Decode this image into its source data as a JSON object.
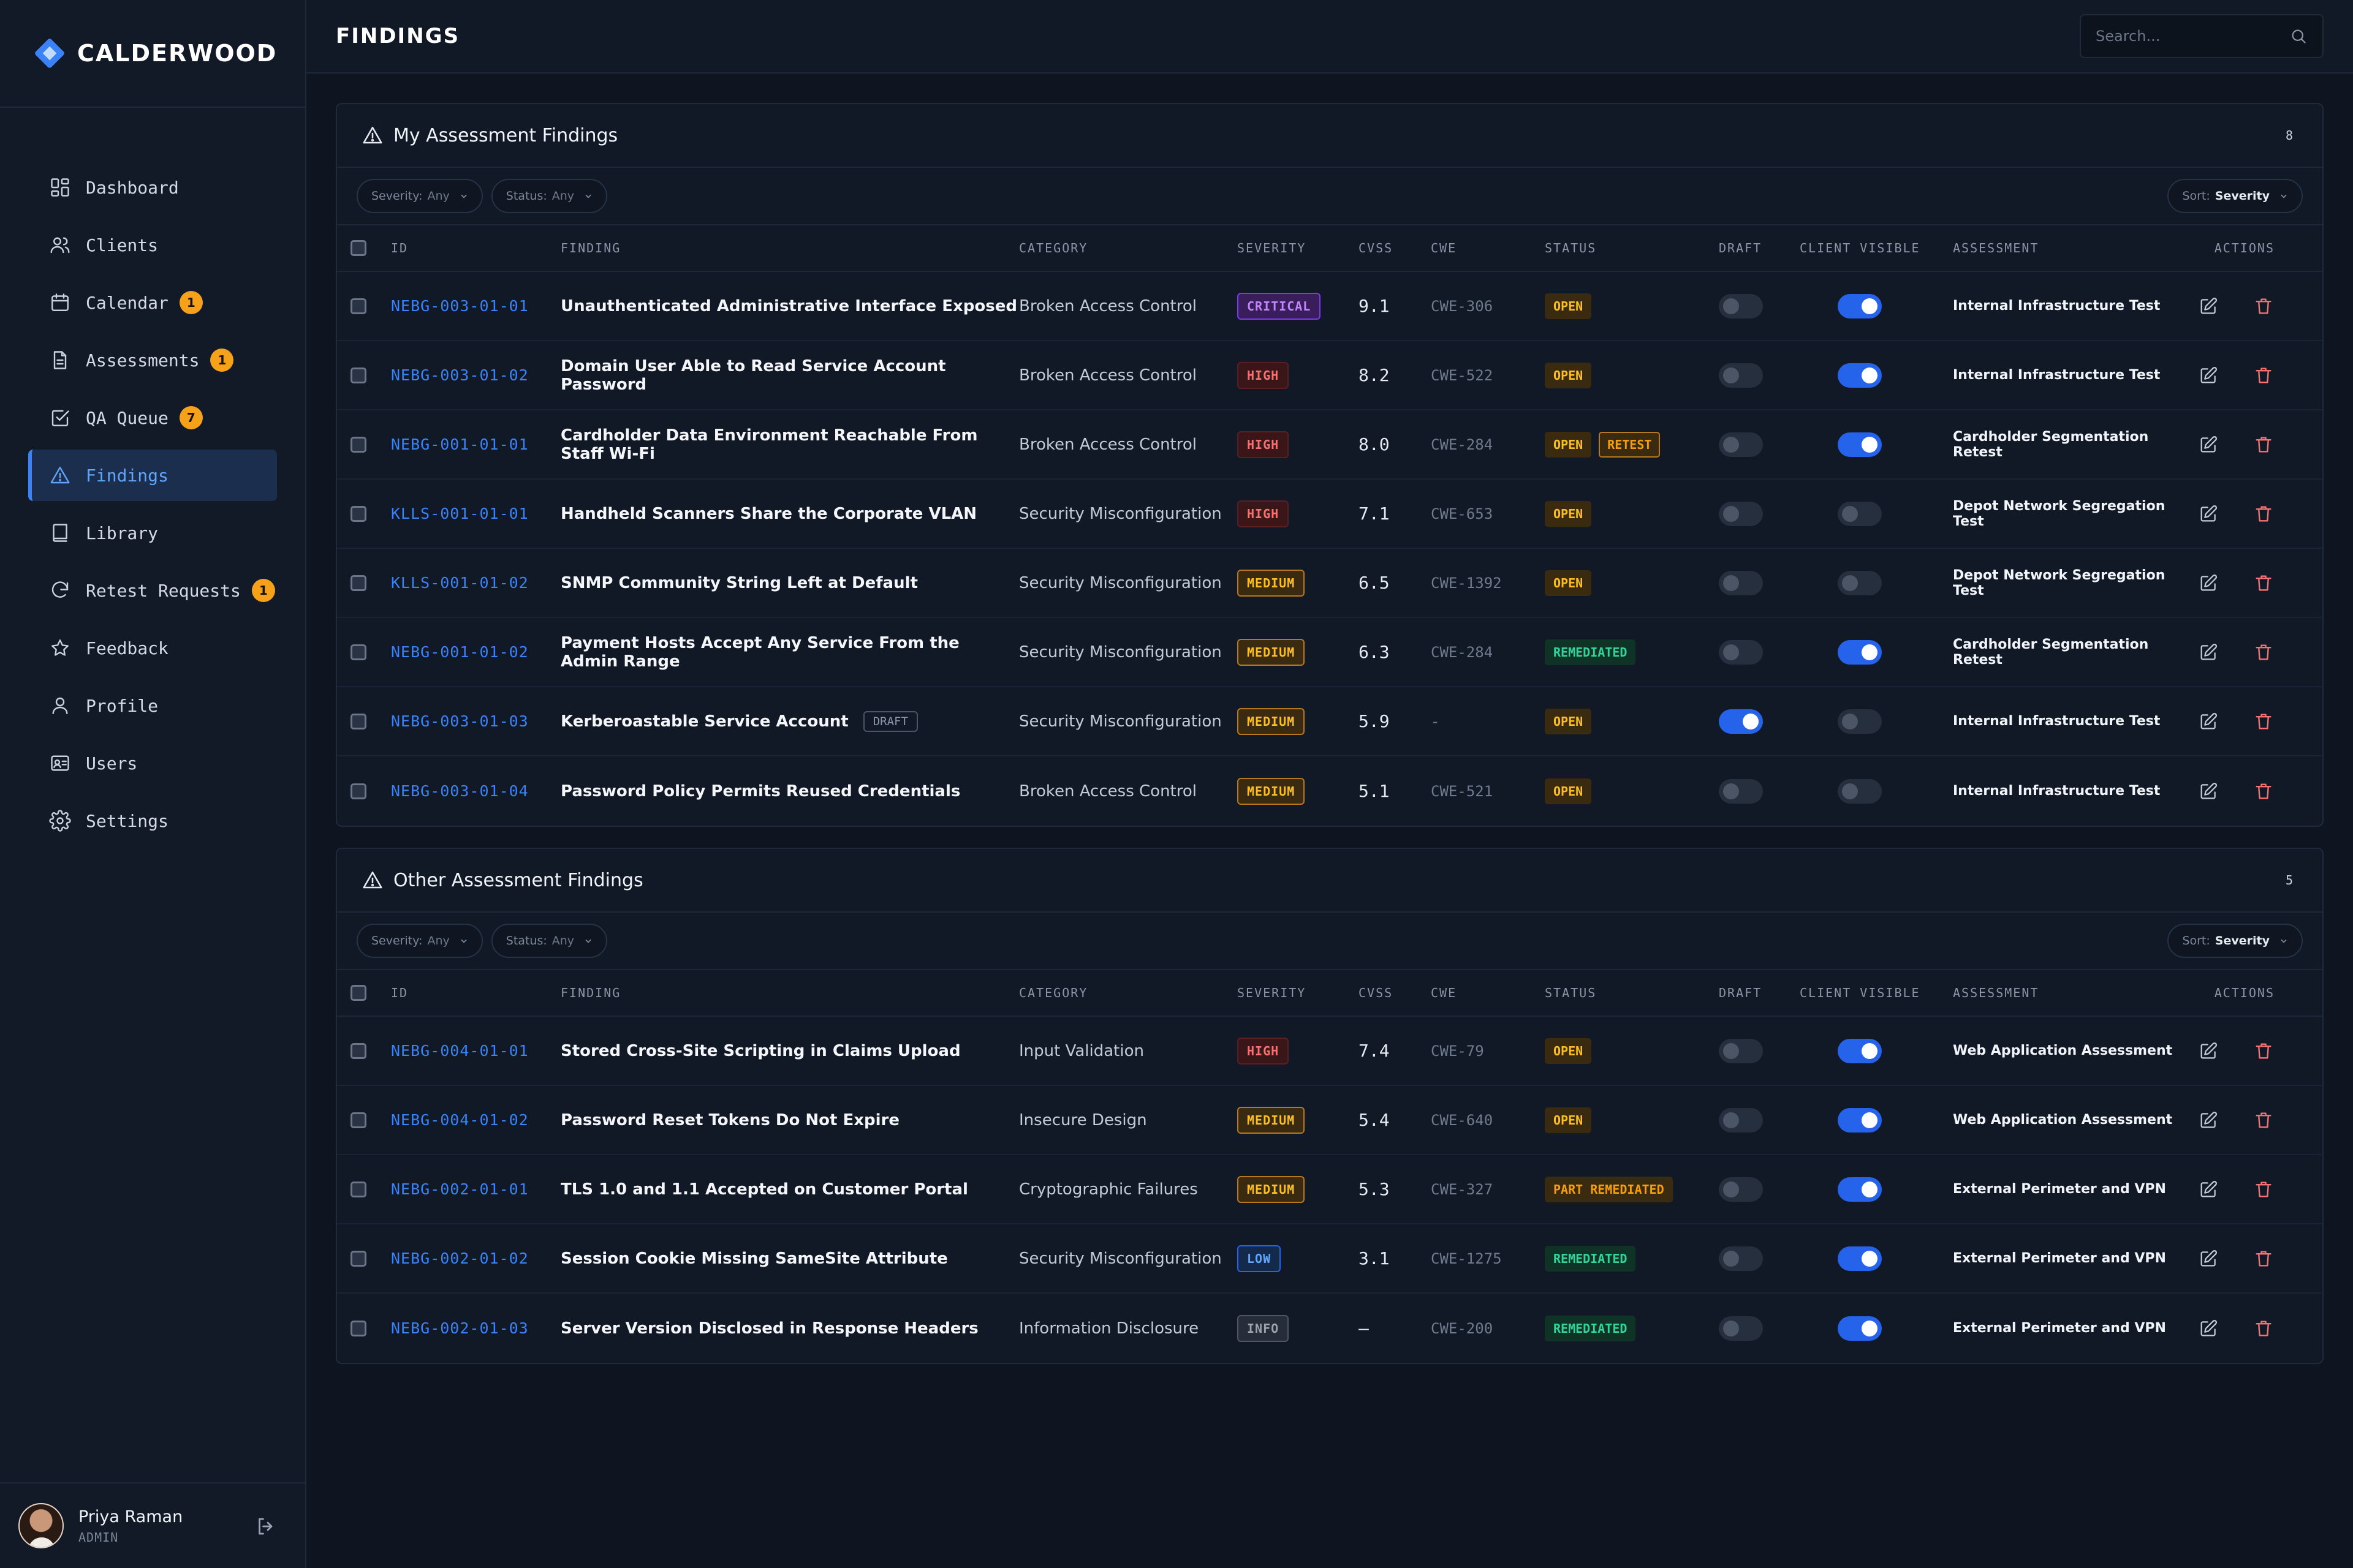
{
  "brand": {
    "name": "CALDERWOOD"
  },
  "nav": [
    {
      "label": "Dashboard",
      "icon": "dashboard-icon",
      "badge": null
    },
    {
      "label": "Clients",
      "icon": "users-icon",
      "badge": null
    },
    {
      "label": "Calendar",
      "icon": "calendar-icon",
      "badge": "1"
    },
    {
      "label": "Assessments",
      "icon": "document-icon",
      "badge": "1"
    },
    {
      "label": "QA Queue",
      "icon": "checkbox-icon",
      "badge": "7"
    },
    {
      "label": "Findings",
      "icon": "warning-icon",
      "badge": null,
      "active": true
    },
    {
      "label": "Library",
      "icon": "book-icon",
      "badge": null
    },
    {
      "label": "Retest Requests",
      "icon": "refresh-icon",
      "badge": "1"
    },
    {
      "label": "Feedback",
      "icon": "star-icon",
      "badge": null
    },
    {
      "label": "Profile",
      "icon": "user-icon",
      "badge": null
    },
    {
      "label": "Users",
      "icon": "id-card-icon",
      "badge": null
    },
    {
      "label": "Settings",
      "icon": "gear-icon",
      "badge": null
    }
  ],
  "user": {
    "name": "Priya Raman",
    "role": "ADMIN"
  },
  "header": {
    "title": "FINDINGS",
    "search_placeholder": "Search..."
  },
  "columns": {
    "id": "ID",
    "finding": "FINDING",
    "category": "CATEGORY",
    "severity": "SEVERITY",
    "cvss": "CVSS",
    "cwe": "CWE",
    "status": "STATUS",
    "draft": "DRAFT",
    "client_visible": "CLIENT VISIBLE",
    "assessment": "ASSESSMENT",
    "actions": "ACTIONS"
  },
  "filters": {
    "severity_label": "Severity:",
    "severity_value": "Any",
    "status_label": "Status:",
    "status_value": "Any",
    "sort_label": "Sort:",
    "sort_value": "Severity"
  },
  "my_findings": {
    "title": "My Assessment Findings",
    "count": "8",
    "rows": [
      {
        "id": "NEBG-003-01-01",
        "finding": "Unauthenticated Administrative Interface Exposed",
        "draft_tag": "",
        "category": "Broken Access Control",
        "severity": "CRITICAL",
        "sev_class": "critical",
        "cvss": "9.1",
        "cwe": "CWE-306",
        "status": [
          {
            "label": "OPEN",
            "cls": "open"
          }
        ],
        "draft": false,
        "client_visible": true,
        "assessment": "Internal Infrastructure Test"
      },
      {
        "id": "NEBG-003-01-02",
        "finding": "Domain User Able to Read Service Account Password",
        "draft_tag": "",
        "category": "Broken Access Control",
        "severity": "HIGH",
        "sev_class": "high",
        "cvss": "8.2",
        "cwe": "CWE-522",
        "status": [
          {
            "label": "OPEN",
            "cls": "open"
          }
        ],
        "draft": false,
        "client_visible": true,
        "assessment": "Internal Infrastructure Test"
      },
      {
        "id": "NEBG-001-01-01",
        "finding": "Cardholder Data Environment Reachable From Staff Wi-Fi",
        "draft_tag": "",
        "category": "Broken Access Control",
        "severity": "HIGH",
        "sev_class": "high",
        "cvss": "8.0",
        "cwe": "CWE-284",
        "status": [
          {
            "label": "OPEN",
            "cls": "open"
          },
          {
            "label": "RETEST",
            "cls": "retest"
          }
        ],
        "draft": false,
        "client_visible": true,
        "assessment": "Cardholder Segmentation Retest"
      },
      {
        "id": "KLLS-001-01-01",
        "finding": "Handheld Scanners Share the Corporate VLAN",
        "draft_tag": "",
        "category": "Security Misconfiguration",
        "severity": "HIGH",
        "sev_class": "high",
        "cvss": "7.1",
        "cwe": "CWE-653",
        "status": [
          {
            "label": "OPEN",
            "cls": "open"
          }
        ],
        "draft": false,
        "client_visible": false,
        "assessment": "Depot Network Segregation Test"
      },
      {
        "id": "KLLS-001-01-02",
        "finding": "SNMP Community String Left at Default",
        "draft_tag": "",
        "category": "Security Misconfiguration",
        "severity": "MEDIUM",
        "sev_class": "medium",
        "cvss": "6.5",
        "cwe": "CWE-1392",
        "status": [
          {
            "label": "OPEN",
            "cls": "open"
          }
        ],
        "draft": false,
        "client_visible": false,
        "assessment": "Depot Network Segregation Test"
      },
      {
        "id": "NEBG-001-01-02",
        "finding": "Payment Hosts Accept Any Service From the Admin Range",
        "draft_tag": "",
        "category": "Security Misconfiguration",
        "severity": "MEDIUM",
        "sev_class": "medium",
        "cvss": "6.3",
        "cwe": "CWE-284",
        "status": [
          {
            "label": "REMEDIATED",
            "cls": "remediated"
          }
        ],
        "draft": false,
        "client_visible": true,
        "assessment": "Cardholder Segmentation Retest"
      },
      {
        "id": "NEBG-003-01-03",
        "finding": "Kerberoastable Service Account",
        "draft_tag": "DRAFT",
        "category": "Security Misconfiguration",
        "severity": "MEDIUM",
        "sev_class": "medium",
        "cvss": "5.9",
        "cwe": "-",
        "status": [
          {
            "label": "OPEN",
            "cls": "open"
          }
        ],
        "draft": true,
        "client_visible": false,
        "assessment": "Internal Infrastructure Test"
      },
      {
        "id": "NEBG-003-01-04",
        "finding": "Password Policy Permits Reused Credentials",
        "draft_tag": "",
        "category": "Broken Access Control",
        "severity": "MEDIUM",
        "sev_class": "medium",
        "cvss": "5.1",
        "cwe": "CWE-521",
        "status": [
          {
            "label": "OPEN",
            "cls": "open"
          }
        ],
        "draft": false,
        "client_visible": false,
        "assessment": "Internal Infrastructure Test"
      }
    ]
  },
  "other_findings": {
    "title": "Other Assessment Findings",
    "count": "5",
    "rows": [
      {
        "id": "NEBG-004-01-01",
        "finding": "Stored Cross-Site Scripting in Claims Upload",
        "draft_tag": "",
        "category": "Input Validation",
        "severity": "HIGH",
        "sev_class": "high",
        "cvss": "7.4",
        "cwe": "CWE-79",
        "status": [
          {
            "label": "OPEN",
            "cls": "open"
          }
        ],
        "draft": false,
        "client_visible": true,
        "assessment": "Web Application Assessment"
      },
      {
        "id": "NEBG-004-01-02",
        "finding": "Password Reset Tokens Do Not Expire",
        "draft_tag": "",
        "category": "Insecure Design",
        "severity": "MEDIUM",
        "sev_class": "medium",
        "cvss": "5.4",
        "cwe": "CWE-640",
        "status": [
          {
            "label": "OPEN",
            "cls": "open"
          }
        ],
        "draft": false,
        "client_visible": true,
        "assessment": "Web Application Assessment"
      },
      {
        "id": "NEBG-002-01-01",
        "finding": "TLS 1.0 and 1.1 Accepted on Customer Portal",
        "draft_tag": "",
        "category": "Cryptographic Failures",
        "severity": "MEDIUM",
        "sev_class": "medium",
        "cvss": "5.3",
        "cwe": "CWE-327",
        "status": [
          {
            "label": "PART REMEDIATED",
            "cls": "part"
          }
        ],
        "draft": false,
        "client_visible": true,
        "assessment": "External Perimeter and VPN"
      },
      {
        "id": "NEBG-002-01-02",
        "finding": "Session Cookie Missing SameSite Attribute",
        "draft_tag": "",
        "category": "Security Misconfiguration",
        "severity": "LOW",
        "sev_class": "low",
        "cvss": "3.1",
        "cwe": "CWE-1275",
        "status": [
          {
            "label": "REMEDIATED",
            "cls": "remediated"
          }
        ],
        "draft": false,
        "client_visible": true,
        "assessment": "External Perimeter and VPN"
      },
      {
        "id": "NEBG-002-01-03",
        "finding": "Server Version Disclosed in Response Headers",
        "draft_tag": "",
        "category": "Information Disclosure",
        "severity": "INFO",
        "sev_class": "info",
        "cvss": "—",
        "cwe": "CWE-200",
        "status": [
          {
            "label": "REMEDIATED",
            "cls": "remediated"
          }
        ],
        "draft": false,
        "client_visible": true,
        "assessment": "External Perimeter and VPN"
      }
    ]
  }
}
